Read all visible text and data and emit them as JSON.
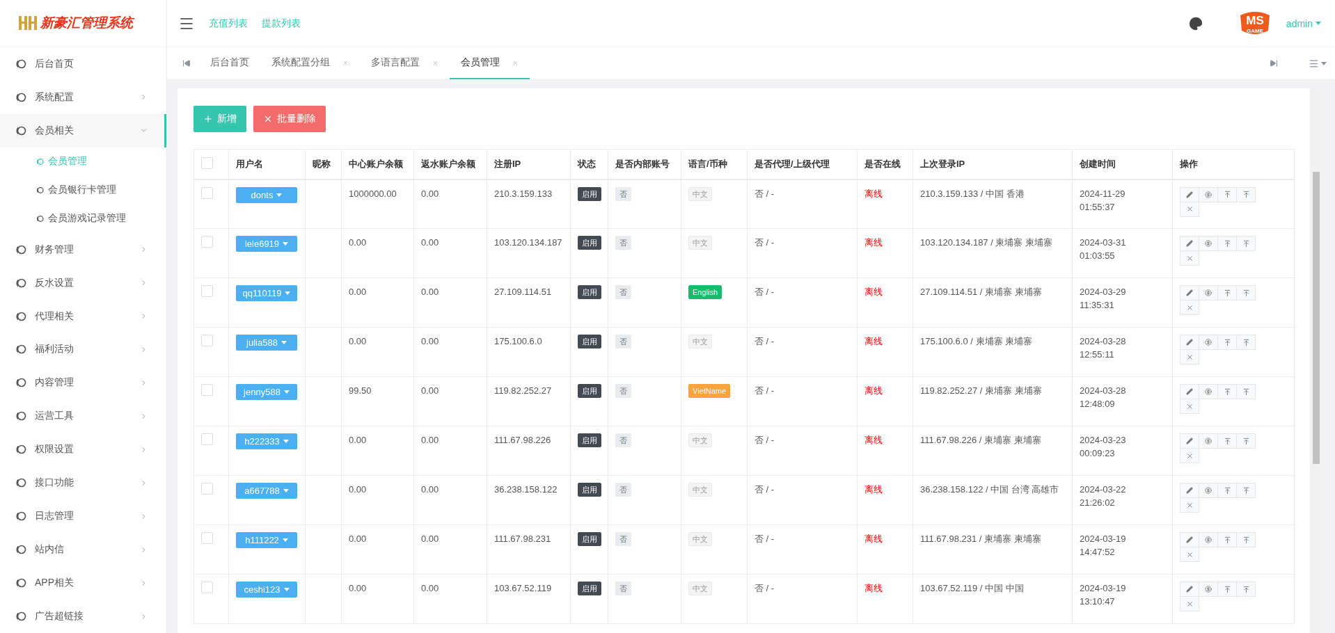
{
  "logo": {
    "title": "新豪汇管理系统"
  },
  "header": {
    "links": [
      "充值列表",
      "提款列表"
    ],
    "avatar_logo": {
      "top": "MS",
      "bottom": "GAME"
    },
    "user": "admin"
  },
  "sidebar": {
    "items": [
      {
        "label": "后台首页",
        "selected": false,
        "has_arrow": false
      },
      {
        "label": "系统配置",
        "expanded": false,
        "selected": false,
        "has_arrow": true
      },
      {
        "label": "会员相关",
        "expanded": true,
        "selected": true,
        "has_arrow": true,
        "children": [
          {
            "label": "会员管理",
            "selected": true
          },
          {
            "label": "会员银行卡管理",
            "selected": false
          },
          {
            "label": "会员游戏记录管理",
            "selected": false
          }
        ]
      },
      {
        "label": "财务管理",
        "expanded": false,
        "selected": false,
        "has_arrow": true
      },
      {
        "label": "反水设置",
        "expanded": false,
        "selected": false,
        "has_arrow": true
      },
      {
        "label": "代理相关",
        "expanded": false,
        "selected": false,
        "has_arrow": true
      },
      {
        "label": "福利活动",
        "expanded": false,
        "selected": false,
        "has_arrow": true
      },
      {
        "label": "内容管理",
        "expanded": false,
        "selected": false,
        "has_arrow": true
      },
      {
        "label": "运营工具",
        "expanded": false,
        "selected": false,
        "has_arrow": true
      },
      {
        "label": "权限设置",
        "expanded": false,
        "selected": false,
        "has_arrow": true
      },
      {
        "label": "接口功能",
        "expanded": false,
        "selected": false,
        "has_arrow": true
      },
      {
        "label": "日志管理",
        "expanded": false,
        "selected": false,
        "has_arrow": true
      },
      {
        "label": "站内信",
        "expanded": false,
        "selected": false,
        "has_arrow": true
      },
      {
        "label": "APP相关",
        "expanded": false,
        "selected": false,
        "has_arrow": true
      },
      {
        "label": "广告超链接",
        "expanded": false,
        "selected": false,
        "has_arrow": true
      }
    ]
  },
  "tabs": [
    {
      "label": "后台首页",
      "closable": false,
      "selected": false
    },
    {
      "label": "系统配置分组",
      "closable": true,
      "selected": false
    },
    {
      "label": "多语言配置",
      "closable": true,
      "selected": false
    },
    {
      "label": "会员管理",
      "closable": true,
      "selected": true
    }
  ],
  "toolbar": {
    "buttons": [
      {
        "kind": "add",
        "label": "新增"
      },
      {
        "kind": "delete",
        "label": "批量删除"
      }
    ]
  },
  "table": {
    "columns": [
      "用户名",
      "昵称",
      "中心账户余额",
      "返水账户余额",
      "注册IP",
      "状态",
      "是否内部账号",
      "语言/币种",
      "是否代理/上级代理",
      "是否在线",
      "上次登录IP",
      "创建时间",
      "操作"
    ],
    "header_checked": false,
    "rows": [
      {
        "checked": false,
        "username": "donts",
        "nickname": "",
        "balance": "1000000.00",
        "rebate": "0.00",
        "reg_ip": "210.3.159.133",
        "status": "启用",
        "internal": "否",
        "lang": {
          "text": "中文",
          "color": "#f4f4f5"
        },
        "agent": "否 / -",
        "online": "离线",
        "last_ip": "210.3.159.133 / 中国 香港",
        "created": [
          "2024-11-29",
          "01:55:37"
        ]
      },
      {
        "checked": false,
        "username": "lele6919",
        "nickname": "",
        "balance": "0.00",
        "rebate": "0.00",
        "reg_ip": "103.120.134.187",
        "status": "启用",
        "internal": "否",
        "lang": {
          "text": "中文",
          "color": "#f4f4f5"
        },
        "agent": "否 / -",
        "online": "离线",
        "last_ip": "103.120.134.187 / 柬埔寨 柬埔寨",
        "created": [
          "2024-03-31",
          "01:03:55"
        ]
      },
      {
        "checked": false,
        "username": "qq110119",
        "nickname": "",
        "balance": "0.00",
        "rebate": "0.00",
        "reg_ip": "27.109.114.51",
        "status": "启用",
        "internal": "否",
        "lang": {
          "text": "English",
          "color": "#18bc6c"
        },
        "agent": "否 / -",
        "online": "离线",
        "last_ip": "27.109.114.51 / 柬埔寨 柬埔寨",
        "created": [
          "2024-03-29",
          "11:35:31"
        ]
      },
      {
        "checked": false,
        "username": "julia588",
        "nickname": "",
        "balance": "0.00",
        "rebate": "0.00",
        "reg_ip": "175.100.6.0",
        "status": "启用",
        "internal": "否",
        "lang": {
          "text": "中文",
          "color": "#f4f4f5"
        },
        "agent": "否 / -",
        "online": "离线",
        "last_ip": "175.100.6.0 / 柬埔寨 柬埔寨",
        "created": [
          "2024-03-28",
          "12:55:11"
        ]
      },
      {
        "checked": false,
        "username": "jenny588",
        "nickname": "",
        "balance": "99.50",
        "rebate": "0.00",
        "reg_ip": "119.82.252.27",
        "status": "启用",
        "internal": "否",
        "lang": {
          "text": "VietName",
          "color": "#f8a33b"
        },
        "agent": "否 / -",
        "online": "离线",
        "last_ip": "119.82.252.27 / 柬埔寨 柬埔寨",
        "created": [
          "2024-03-28",
          "12:48:09"
        ]
      },
      {
        "checked": false,
        "username": "h222333",
        "nickname": "",
        "balance": "0.00",
        "rebate": "0.00",
        "reg_ip": "111.67.98.226",
        "status": "启用",
        "internal": "否",
        "lang": {
          "text": "中文",
          "color": "#f4f4f5"
        },
        "agent": "否 / -",
        "online": "离线",
        "last_ip": "111.67.98.226 / 柬埔寨 柬埔寨",
        "created": [
          "2024-03-23",
          "00:09:23"
        ]
      },
      {
        "checked": false,
        "username": "a667788",
        "nickname": "",
        "balance": "0.00",
        "rebate": "0.00",
        "reg_ip": "36.238.158.122",
        "status": "启用",
        "internal": "否",
        "lang": {
          "text": "中文",
          "color": "#f4f4f5"
        },
        "agent": "否 / -",
        "online": "离线",
        "last_ip": "36.238.158.122 / 中国 台湾 高雄市",
        "created": [
          "2024-03-22",
          "21:26:02"
        ]
      },
      {
        "checked": false,
        "username": "h111222",
        "nickname": "",
        "balance": "0.00",
        "rebate": "0.00",
        "reg_ip": "111.67.98.231",
        "status": "启用",
        "internal": "否",
        "lang": {
          "text": "中文",
          "color": "#f4f4f5"
        },
        "agent": "否 / -",
        "online": "离线",
        "last_ip": "111.67.98.231 / 柬埔寨 柬埔寨",
        "created": [
          "2024-03-19",
          "14:47:52"
        ]
      },
      {
        "checked": false,
        "username": "ceshi123",
        "nickname": "",
        "balance": "0.00",
        "rebate": "0.00",
        "reg_ip": "103.67.52.119",
        "status": "启用",
        "internal": "否",
        "lang": {
          "text": "中文",
          "color": "#f4f4f5"
        },
        "agent": "否 / -",
        "online": "离线",
        "last_ip": "103.67.52.119 / 中国 中国",
        "created": [
          "2024-03-19",
          "13:10:47"
        ]
      }
    ]
  }
}
